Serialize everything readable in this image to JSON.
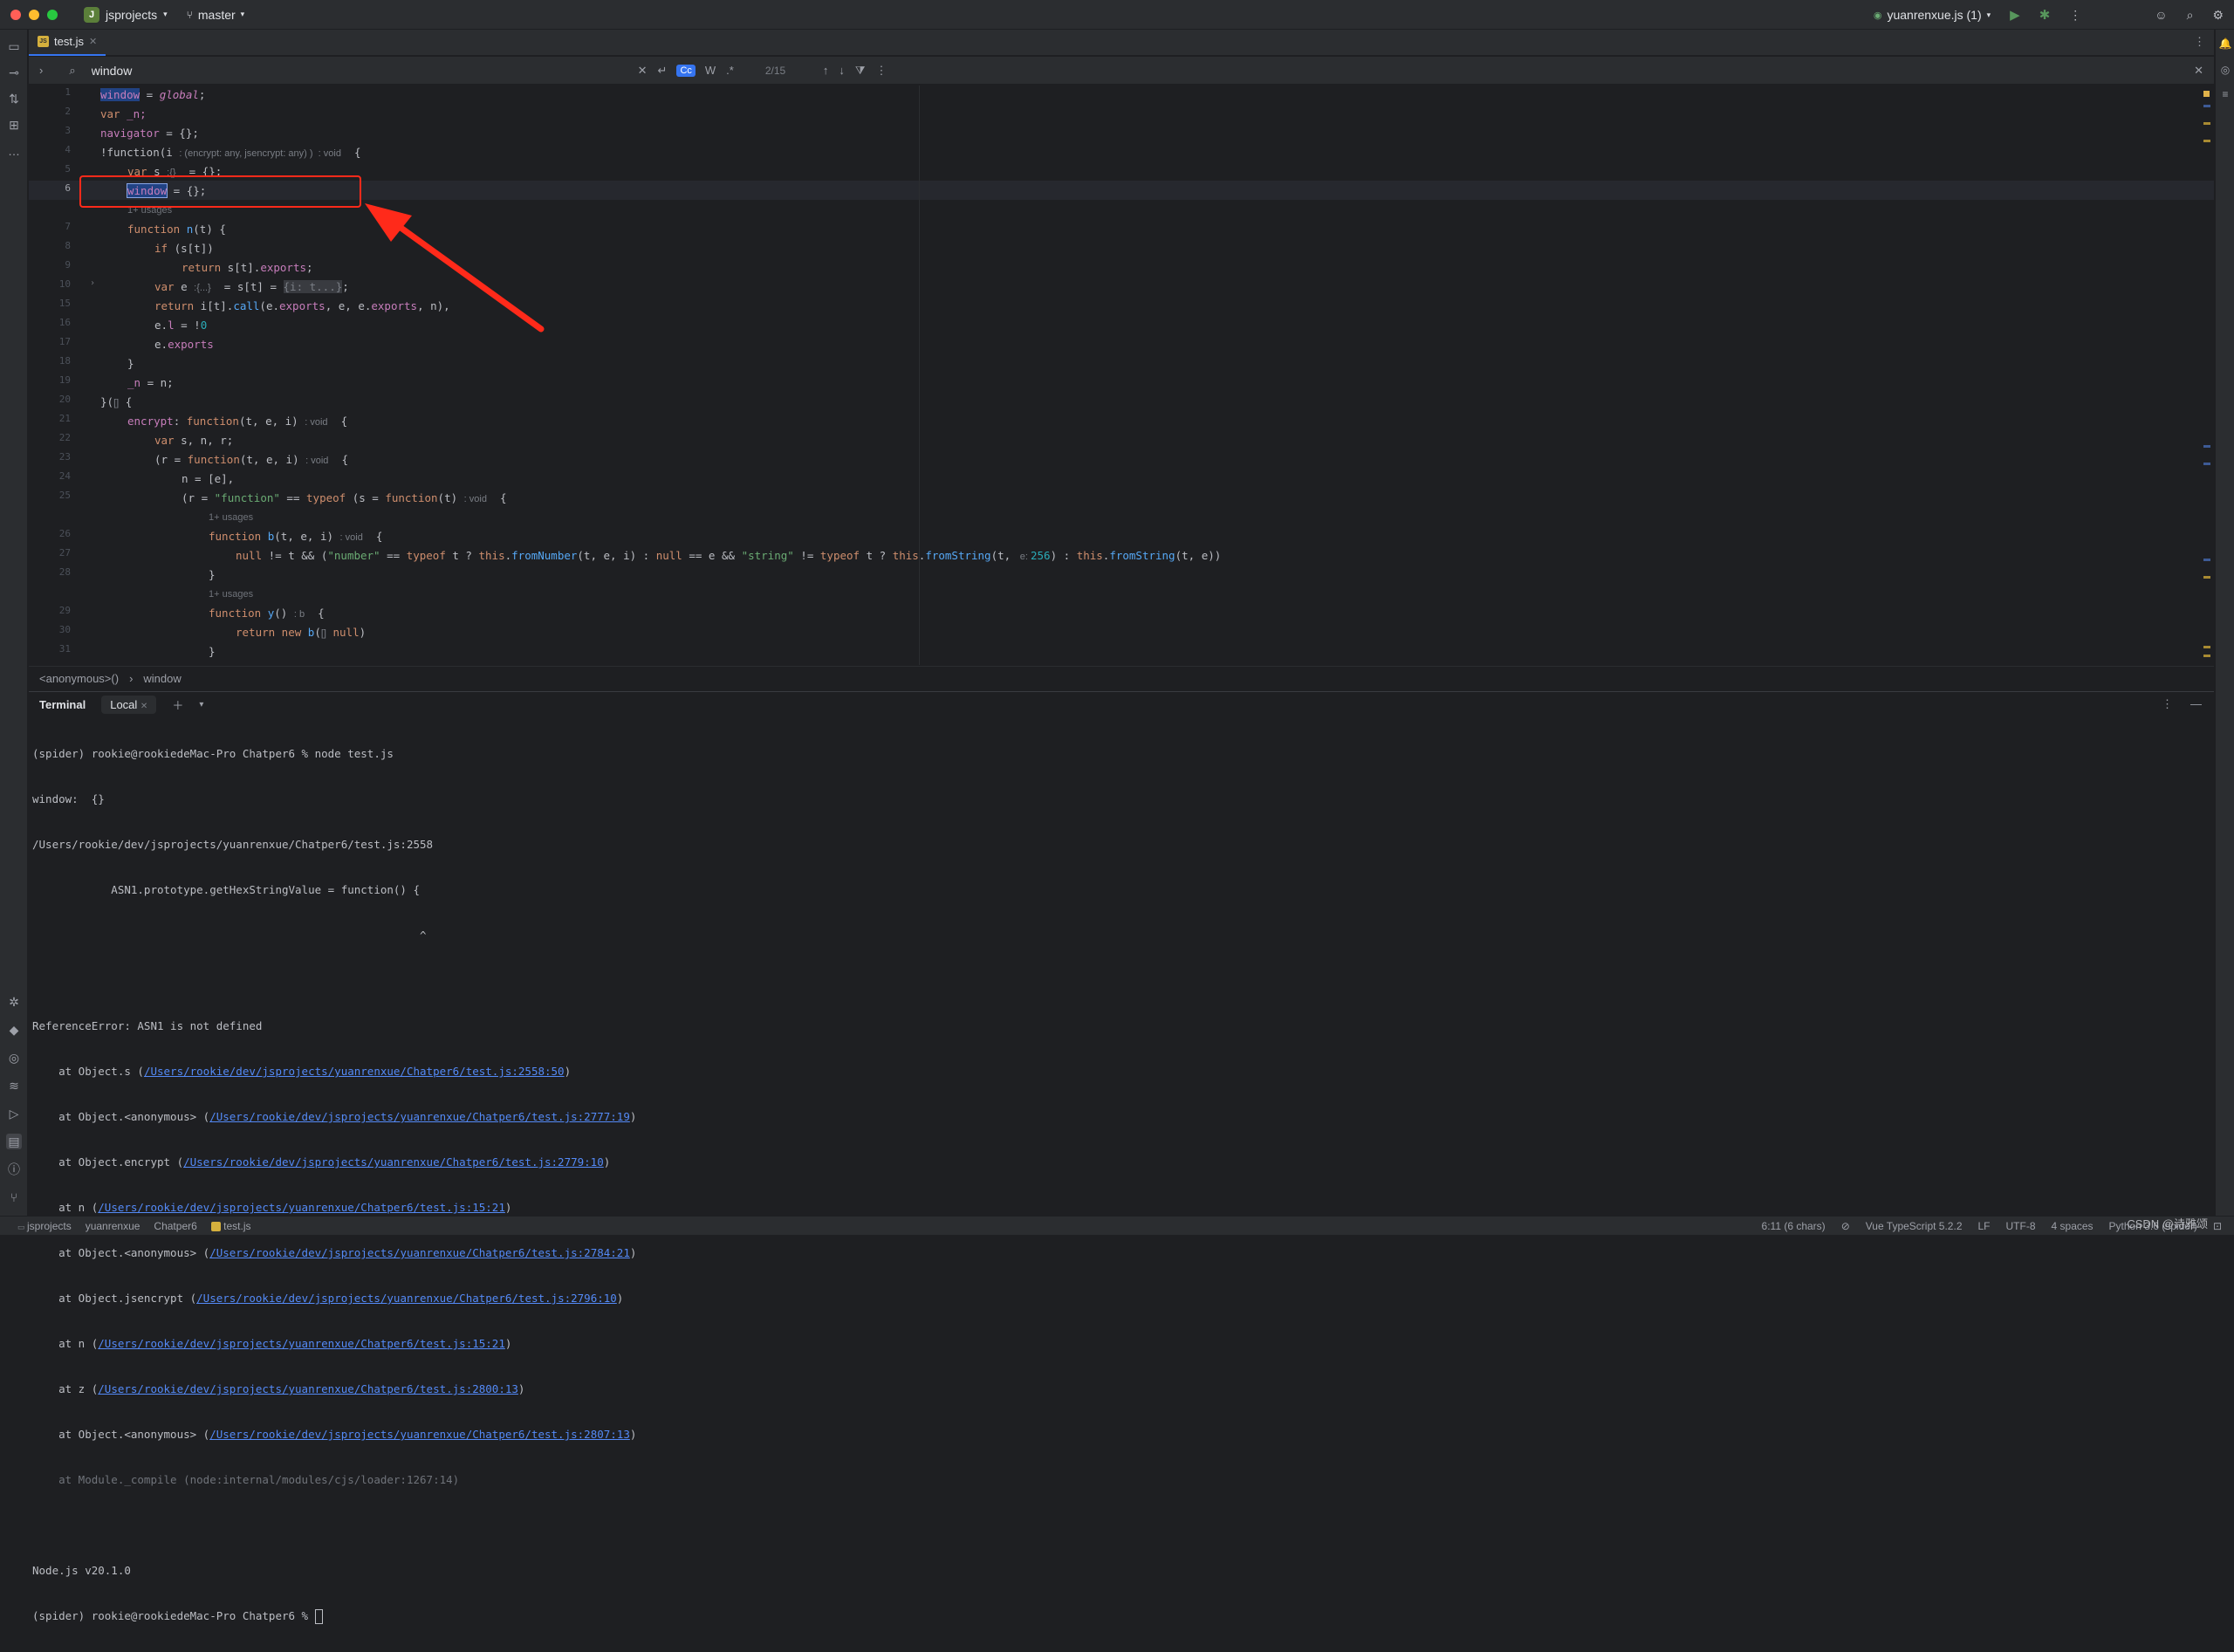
{
  "titlebar": {
    "project_badge": "J",
    "project_name": "jsprojects",
    "branch": "master",
    "run_config": "yuanrenxue.js (1)"
  },
  "editor_tab": {
    "badge": "JS",
    "filename": "test.js"
  },
  "search": {
    "query": "window",
    "match_case": "Cc",
    "words": "W",
    "regex": ".*",
    "match_count": "2/15"
  },
  "gutter_lines": [
    "1",
    "2",
    "3",
    "4",
    "5",
    "6",
    "7",
    "8",
    "9",
    "10",
    "15",
    "16",
    "17",
    "18",
    "19",
    "20",
    "21",
    "22",
    "23",
    "24",
    "25",
    "26",
    "27",
    "28",
    "29",
    "30",
    "31"
  ],
  "code": {
    "l1_a": "window",
    "l1_b": " = ",
    "l1_c": "global",
    "l1_d": ";",
    "l2_a": "var",
    "l2_b": " _n;",
    "l3_a": "navigator",
    "l3_b": " = {};",
    "l4_a": "!function(i ",
    "l4_hint": ": (encrypt: any, jsencrypt: any) )  : void",
    "l4_b": "  {",
    "l5_a": "var",
    "l5_b": " s ",
    "l5_hint": ":{}",
    "l5_c": "  = {};",
    "l6_a": "window",
    "l6_b": " = {};",
    "usages_a": "1+ usages",
    "l7_a": "function",
    "l7_b": " n",
    "l7_c": "(t) {",
    "l8_a": "if",
    "l8_b": " (s[t])",
    "l9_a": "return",
    "l9_b": " s[t].",
    "l9_c": "exports",
    "l9_d": ";",
    "l10_a": "var",
    "l10_b": " e ",
    "l10_hint": ":{...}",
    "l10_c": "  = s[t] = ",
    "l10_d": "{i: t...}",
    "l10_e": ";",
    "l15_a": "return",
    "l15_b": " i[t].",
    "l15_c": "call",
    "l15_d": "(e.",
    "l15_e": "exports",
    "l15_f": ", e, e.",
    "l15_g": "exports",
    "l15_h": ", n),",
    "l16_a": "e.",
    "l16_b": "l",
    "l16_c": " = !",
    "l16_d": "0",
    "l17_a": "e.",
    "l17_b": "exports",
    "l18_a": "}",
    "l19_a": "_n",
    "l19_b": " = n;",
    "l20_a": "}(",
    "l20_hint": "[]",
    "l20_b": " {",
    "l21_a": "encrypt",
    "l21_b": ": ",
    "l21_c": "function",
    "l21_d": "(t, e, i) ",
    "l21_hint": ": void",
    "l21_e": "  {",
    "l22_a": "var",
    "l22_b": " s, n, r;",
    "l23_a": "(r = ",
    "l23_b": "function",
    "l23_c": "(t, e, i) ",
    "l23_hint": ": void",
    "l23_d": "  {",
    "l24_a": "n = [e],",
    "l25_a": "(r = ",
    "l25_b": "\"function\"",
    "l25_c": " == ",
    "l25_d": "typeof",
    "l25_e": " (s = ",
    "l25_f": "function",
    "l25_g": "(t) ",
    "l25_hint": ": void",
    "l25_h": "  {",
    "usages_b": "1+ usages",
    "l26_a": "function",
    "l26_b": " b",
    "l26_c": "(t, e, i) ",
    "l26_hint": ": void",
    "l26_d": "  {",
    "l27_a": "null",
    "l27_b": " != t && (",
    "l27_c": "\"number\"",
    "l27_d": " == ",
    "l27_e": "typeof",
    "l27_f": " t ? ",
    "l27_g": "this",
    "l27_h": ".",
    "l27_i": "fromNumber",
    "l27_j": "(t, e, i) : ",
    "l27_k": "null",
    "l27_l": " == e && ",
    "l27_m": "\"string\"",
    "l27_n": " != ",
    "l27_o": "typeof",
    "l27_p": " t ? ",
    "l27_q": "this",
    "l27_r": ".",
    "l27_s": "fromString",
    "l27_t": "(t, ",
    "l27_hint": " e: ",
    "l27_u": "256",
    "l27_v": ") : ",
    "l27_w": "this",
    "l27_x": ".",
    "l27_y": "fromString",
    "l27_z": "(t, e))",
    "l28_a": "}",
    "usages_c": "1+ usages",
    "l29_a": "function",
    "l29_b": " y",
    "l29_c": "() ",
    "l29_hint": ": b",
    "l29_d": "  {",
    "l30_a": "return",
    "l30_b": " new",
    "l30_c": " b",
    "l30_d": "(",
    "l30_hint": "[]",
    "l30_e": " null",
    "l30_f": ")",
    "l31_a": "}"
  },
  "breadcrumbs": {
    "a": "<anonymous>()",
    "sep": "›",
    "b": "window"
  },
  "terminal": {
    "title": "Terminal",
    "tab": "Local",
    "lines": [
      {
        "t": "(spider) rookie@rookiedeMac-Pro Chatper6 % node test.js"
      },
      {
        "t": "window:  {}"
      },
      {
        "t": "/Users/rookie/dev/jsprojects/yuanrenxue/Chatper6/test.js:2558"
      },
      {
        "t": "            ASN1.prototype.getHexStringValue = function() {"
      },
      {
        "t": "                                                           ^"
      },
      {
        "t": ""
      },
      {
        "t": "ReferenceError: ASN1 is not defined"
      },
      {
        "pre": "    at Object.s (",
        "link": "/Users/rookie/dev/jsprojects/yuanrenxue/Chatper6/test.js:2558:50",
        "post": ")"
      },
      {
        "pre": "    at Object.<anonymous> (",
        "link": "/Users/rookie/dev/jsprojects/yuanrenxue/Chatper6/test.js:2777:19",
        "post": ")"
      },
      {
        "pre": "    at Object.encrypt (",
        "link": "/Users/rookie/dev/jsprojects/yuanrenxue/Chatper6/test.js:2779:10",
        "post": ")"
      },
      {
        "pre": "    at n (",
        "link": "/Users/rookie/dev/jsprojects/yuanrenxue/Chatper6/test.js:15:21",
        "post": ")"
      },
      {
        "pre": "    at Object.<anonymous> (",
        "link": "/Users/rookie/dev/jsprojects/yuanrenxue/Chatper6/test.js:2784:21",
        "post": ")"
      },
      {
        "pre": "    at Object.jsencrypt (",
        "link": "/Users/rookie/dev/jsprojects/yuanrenxue/Chatper6/test.js:2796:10",
        "post": ")"
      },
      {
        "pre": "    at n (",
        "link": "/Users/rookie/dev/jsprojects/yuanrenxue/Chatper6/test.js:15:21",
        "post": ")"
      },
      {
        "pre": "    at z (",
        "link": "/Users/rookie/dev/jsprojects/yuanrenxue/Chatper6/test.js:2800:13",
        "post": ")"
      },
      {
        "pre": "    at Object.<anonymous> (",
        "link": "/Users/rookie/dev/jsprojects/yuanrenxue/Chatper6/test.js:2807:13",
        "post": ")"
      },
      {
        "dim": "    at Module._compile (node:internal/modules/cjs/loader:1267:14)"
      },
      {
        "t": ""
      },
      {
        "t": "Node.js v20.1.0"
      },
      {
        "t": "(spider) rookie@rookiedeMac-Pro Chatper6 % "
      }
    ]
  },
  "statusbar": {
    "crumb1": "jsprojects",
    "crumb2": "yuanrenxue",
    "crumb3": "Chatper6",
    "crumb4": "test.js",
    "position": "6:11 (6 chars)",
    "language": "Vue TypeScript 5.2.2",
    "line_sep": "LF",
    "encoding": "UTF-8",
    "indent": "4 spaces",
    "interpreter": "Python 3.6 (spider)",
    "watermark": "CSDN @诗雅颂"
  },
  "colors": {
    "accent": "#3574f0",
    "annotation": "#ff2a1a"
  }
}
